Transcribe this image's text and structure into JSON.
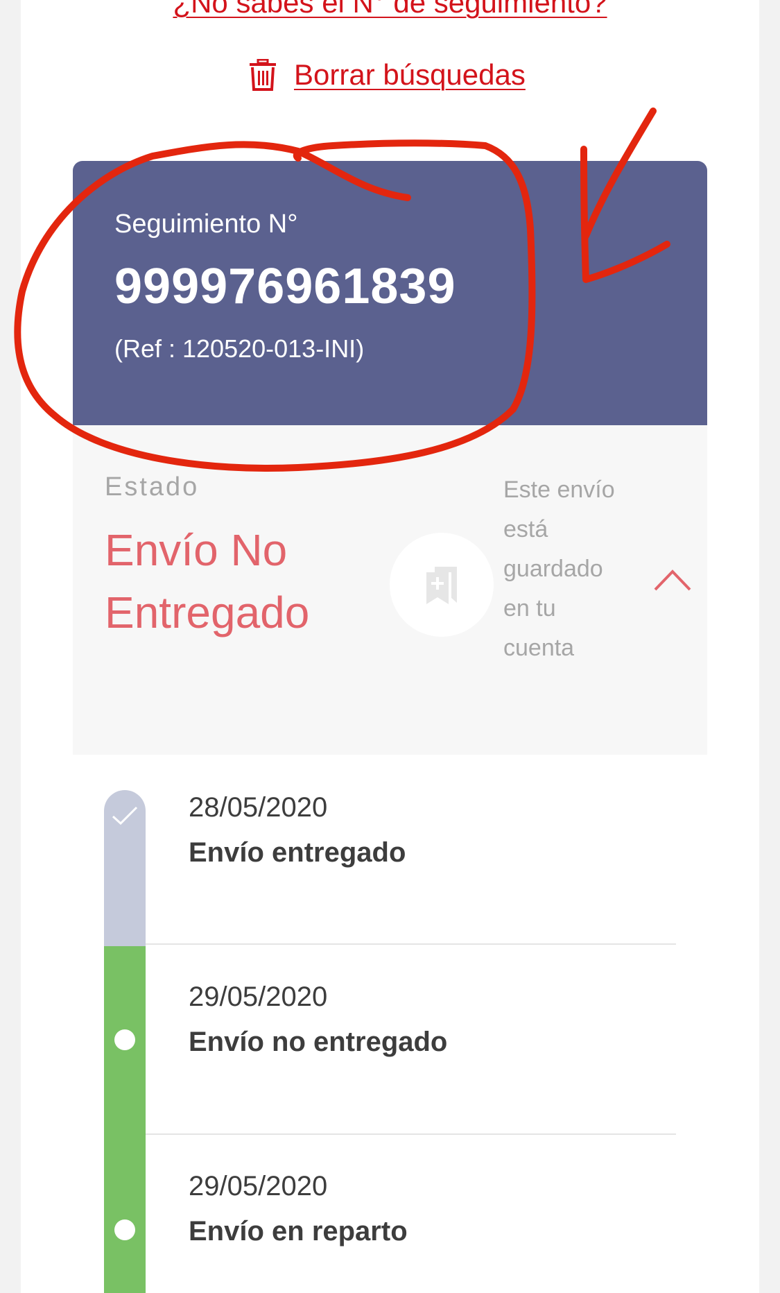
{
  "links": {
    "unknown_tracking": "¿No sabes el N° de seguimiento?",
    "clear_searches": "Borrar búsquedas"
  },
  "tracking": {
    "label": "Seguimiento N°",
    "number": "999976961839",
    "reference": "(Ref : 120520-013-INI)"
  },
  "status": {
    "label": "Estado",
    "value": "Envío No Entregado",
    "saved_message": "Este envío está guardado en tu cuenta"
  },
  "events": [
    {
      "date": "28/05/2020",
      "description": "Envío entregado",
      "state": "check"
    },
    {
      "date": "29/05/2020",
      "description": "Envío no entregado",
      "state": "dot"
    },
    {
      "date": "29/05/2020",
      "description": "Envío en reparto",
      "state": "dot"
    }
  ],
  "colors": {
    "accent_red": "#d3131b",
    "card_header": "#5b618f",
    "status_red": "#e2646b",
    "timeline_grey": "#c5cadb",
    "timeline_green": "#79c164",
    "annotation_red": "#e3260e"
  },
  "icons": {
    "delete": "trash-icon",
    "save": "bookmark-add-icon",
    "collapse": "chevron-up-icon",
    "done": "check-icon"
  }
}
